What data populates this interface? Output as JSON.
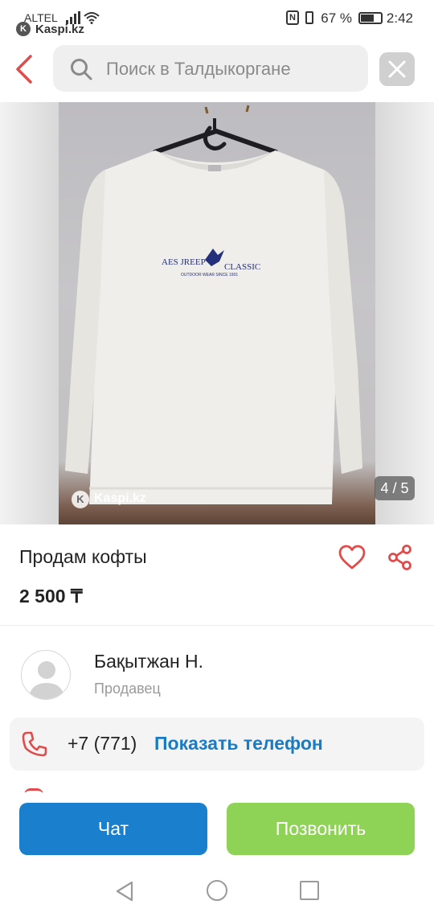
{
  "status_bar": {
    "carrier": "ALTEL",
    "app_badge": "Kaspi.kz",
    "nfc": "N",
    "battery": "67 %",
    "time": "2:42"
  },
  "search": {
    "placeholder": "Поиск в Талдыкоргане"
  },
  "gallery": {
    "watermark": "Kaspi.kz",
    "counter": "4 / 5",
    "current": 4,
    "total": 5,
    "shirt_print": {
      "line1_left": "AES JREEP",
      "line1_right": "CLASSIC",
      "line2": "OUTDOOR WEAR SINCE 1901"
    }
  },
  "listing": {
    "title": "Продам кофты",
    "price": "2 500 ₸"
  },
  "seller": {
    "name": "Бақытжан Н.",
    "role": "Продавец"
  },
  "phone": {
    "prefix": "+7 (771)",
    "show_label": "Показать телефон"
  },
  "actions": {
    "chat": "Чат",
    "call": "Позвонить"
  },
  "colors": {
    "accent_red": "#e04b4b",
    "link_blue": "#1b7bc2",
    "chat_blue": "#1a7fcc",
    "call_green": "#8ed355"
  }
}
